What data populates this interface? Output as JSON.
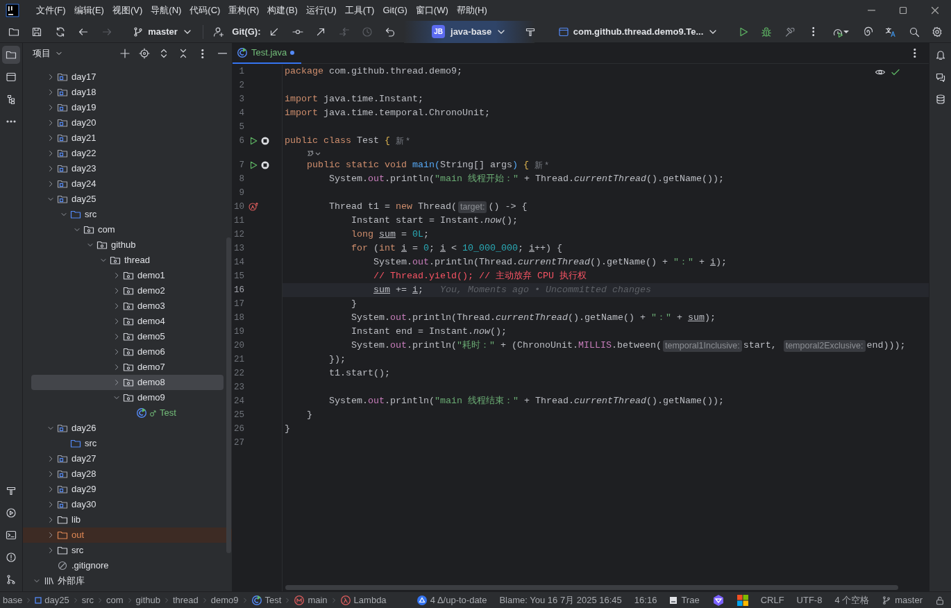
{
  "title_bar": {
    "menu": [
      "文件(F)",
      "编辑(E)",
      "视图(V)",
      "导航(N)",
      "代码(C)",
      "重构(R)",
      "构建(B)",
      "运行(U)",
      "工具(T)",
      "Git(G)",
      "窗口(W)",
      "帮助(H)"
    ]
  },
  "toolbar": {
    "nav": [
      {
        "kind": "folder",
        "disabled": false
      },
      {
        "kind": "save",
        "disabled": false
      },
      {
        "kind": "sync",
        "disabled": false
      },
      {
        "kind": "back",
        "disabled": false
      },
      {
        "kind": "forward",
        "disabled": true
      }
    ],
    "branch": "master",
    "git_label": "Git(G):",
    "git_actions": [
      {
        "kind": "update",
        "disabled": false
      },
      {
        "kind": "commit",
        "disabled": false
      },
      {
        "kind": "push",
        "disabled": false
      },
      {
        "kind": "merge",
        "disabled": true
      },
      {
        "kind": "history",
        "disabled": true
      },
      {
        "kind": "rollback",
        "disabled": false
      }
    ],
    "project": {
      "badge": "JB",
      "name": "java-base"
    },
    "run_config": "com.github.thread.demo9.Te..."
  },
  "left_strip": [
    {
      "kind": "folder",
      "selected": true
    },
    {
      "kind": "commit",
      "selected": false
    },
    {
      "kind": "structure",
      "selected": false
    },
    {
      "kind": "more",
      "selected": false
    }
  ],
  "left_strip_bottom": [
    {
      "kind": "build",
      "selected": false
    },
    {
      "kind": "run",
      "selected": false
    },
    {
      "kind": "terminal",
      "selected": false
    },
    {
      "kind": "problems",
      "selected": false
    },
    {
      "kind": "git",
      "selected": false
    }
  ],
  "project_panel": {
    "title": "项目",
    "tree": [
      {
        "label": "day17",
        "kind": "module",
        "expanded": false,
        "selected": false
      },
      {
        "label": "day18",
        "kind": "module",
        "expanded": false,
        "selected": false
      },
      {
        "label": "day19",
        "kind": "module",
        "expanded": false,
        "selected": false
      },
      {
        "label": "day20",
        "kind": "module",
        "expanded": false,
        "selected": false
      },
      {
        "label": "day21",
        "kind": "module",
        "expanded": false,
        "selected": false
      },
      {
        "label": "day22",
        "kind": "module",
        "expanded": false,
        "selected": false
      },
      {
        "label": "day23",
        "kind": "module",
        "expanded": false,
        "selected": false
      },
      {
        "label": "day24",
        "kind": "module",
        "expanded": false,
        "selected": false
      },
      {
        "label": "day25",
        "kind": "module",
        "expanded": true,
        "selected": false,
        "children": [
          {
            "label": "src",
            "kind": "source",
            "expanded": true,
            "selected": false,
            "children": [
              {
                "label": "com",
                "kind": "package",
                "expanded": true,
                "selected": false,
                "children": [
                  {
                    "label": "github",
                    "kind": "package",
                    "expanded": true,
                    "selected": false,
                    "children": [
                      {
                        "label": "thread",
                        "kind": "package",
                        "expanded": true,
                        "selected": false,
                        "children": [
                          {
                            "label": "demo1",
                            "kind": "package",
                            "expanded": false,
                            "selected": false
                          },
                          {
                            "label": "demo2",
                            "kind": "package",
                            "expanded": false,
                            "selected": false
                          },
                          {
                            "label": "demo3",
                            "kind": "package",
                            "expanded": false,
                            "selected": false
                          },
                          {
                            "label": "demo4",
                            "kind": "package",
                            "expanded": false,
                            "selected": false
                          },
                          {
                            "label": "demo5",
                            "kind": "package",
                            "expanded": false,
                            "selected": false
                          },
                          {
                            "label": "demo6",
                            "kind": "package",
                            "expanded": false,
                            "selected": false
                          },
                          {
                            "label": "demo7",
                            "kind": "package",
                            "expanded": false,
                            "selected": false
                          },
                          {
                            "label": "demo8",
                            "kind": "package",
                            "expanded": false,
                            "selected": true
                          },
                          {
                            "label": "demo9",
                            "kind": "package",
                            "expanded": true,
                            "selected": false,
                            "children": [
                              {
                                "label": "Test",
                                "kind": "class",
                                "added": true,
                                "selected": false
                              }
                            ]
                          }
                        ]
                      }
                    ]
                  }
                ]
              }
            ]
          }
        ]
      },
      {
        "label": "day26",
        "kind": "module",
        "expanded": true,
        "selected": false,
        "children": [
          {
            "label": "src",
            "kind": "source",
            "selected": false
          }
        ]
      },
      {
        "label": "day27",
        "kind": "module",
        "expanded": false,
        "selected": false
      },
      {
        "label": "day28",
        "kind": "module",
        "expanded": false,
        "selected": false
      },
      {
        "label": "day29",
        "kind": "module",
        "expanded": false,
        "selected": false
      },
      {
        "label": "day30",
        "kind": "module",
        "expanded": false,
        "selected": false
      },
      {
        "label": "lib",
        "kind": "folder",
        "expanded": false,
        "selected": false
      },
      {
        "label": "out",
        "kind": "excluded",
        "expanded": false,
        "selected": false
      },
      {
        "label": "src",
        "kind": "folder",
        "expanded": false,
        "selected": false
      },
      {
        "label": ".gitignore",
        "kind": "ignore",
        "selected": false
      }
    ]
  },
  "external_libraries": {
    "label": "外部库",
    "expanded": true
  },
  "editor": {
    "tabs": [
      {
        "label": "Test.java",
        "modified": true,
        "selected": true
      }
    ],
    "lines": [
      {
        "num": "1",
        "tokens": [
          {
            "kind": "kw",
            "t": "package"
          },
          {
            "kind": "p",
            "t": " com.github.thread.demo9;"
          }
        ]
      },
      {
        "num": "2"
      },
      {
        "num": "3",
        "tokens": [
          {
            "kind": "kw",
            "t": "import"
          },
          {
            "kind": "p",
            "t": " java.time.Instant;"
          }
        ]
      },
      {
        "num": "4",
        "tokens": [
          {
            "kind": "kw",
            "t": "import"
          },
          {
            "kind": "p",
            "t": " java.time.temporal.ChronoUnit;"
          }
        ]
      },
      {
        "num": "5"
      },
      {
        "num": "6",
        "gutter": [
          {
            "kind": "run"
          },
          {
            "kind": "stop"
          }
        ],
        "tokens": [
          {
            "kind": "kw",
            "t": "public class"
          },
          {
            "kind": "p",
            "t": " Test "
          },
          {
            "kind": "y",
            "t": "{"
          },
          {
            "kind": "g",
            "t": "新 *"
          }
        ]
      },
      {
        "num": "7",
        "vision": true,
        "gutter": [
          {
            "kind": "run"
          },
          {
            "kind": "stop"
          }
        ],
        "tokens": [
          {
            "kind": "kw",
            "t": "    public static void "
          },
          {
            "kind": "m",
            "t": "main"
          },
          {
            "kind": "b",
            "t": "("
          },
          {
            "kind": "p",
            "t": "String[] args"
          },
          {
            "kind": "b",
            "t": ") "
          },
          {
            "kind": "y",
            "t": "{"
          },
          {
            "kind": "g",
            "t": "新 *"
          }
        ]
      },
      {
        "num": "8",
        "tokens": [
          {
            "kind": "p",
            "t": "        System."
          },
          {
            "kind": "f",
            "t": "out"
          },
          {
            "kind": "p",
            "t": ".println("
          },
          {
            "kind": "s",
            "t": "\"main 线程开始：\""
          },
          {
            "kind": "p",
            "t": " + Thread."
          },
          {
            "kind": "i",
            "t": "currentThread"
          },
          {
            "kind": "p",
            "t": "().getName());"
          }
        ]
      },
      {
        "num": "9"
      },
      {
        "num": "10",
        "gutter": [
          {
            "kind": "lambda"
          }
        ],
        "tokens": [
          {
            "kind": "p",
            "t": "        Thread t1 = "
          },
          {
            "kind": "kw",
            "t": "new"
          },
          {
            "kind": "p",
            "t": " Thread("
          },
          {
            "kind": "h",
            "t": "target:"
          },
          {
            "kind": "p",
            "t": "() -> {"
          }
        ]
      },
      {
        "num": "11",
        "tokens": [
          {
            "kind": "p",
            "t": "            Instant start = Instant."
          },
          {
            "kind": "i",
            "t": "now"
          },
          {
            "kind": "p",
            "t": "();"
          }
        ]
      },
      {
        "num": "12",
        "tokens": [
          {
            "kind": "kw",
            "t": "            long "
          },
          {
            "kind": "u",
            "t": "sum"
          },
          {
            "kind": "p",
            "t": " = "
          },
          {
            "kind": "n",
            "t": "0L"
          },
          {
            "kind": "p",
            "t": ";"
          }
        ]
      },
      {
        "num": "13",
        "tokens": [
          {
            "kind": "kw",
            "t": "            for"
          },
          {
            "kind": "p",
            "t": " ("
          },
          {
            "kind": "kw",
            "t": "int "
          },
          {
            "kind": "u",
            "t": "i"
          },
          {
            "kind": "p",
            "t": " = "
          },
          {
            "kind": "n",
            "t": "0"
          },
          {
            "kind": "p",
            "t": "; "
          },
          {
            "kind": "u",
            "t": "i"
          },
          {
            "kind": "p",
            "t": " < "
          },
          {
            "kind": "n",
            "t": "10_000_000"
          },
          {
            "kind": "p",
            "t": "; "
          },
          {
            "kind": "u",
            "t": "i"
          },
          {
            "kind": "p",
            "t": "++) {"
          }
        ]
      },
      {
        "num": "14",
        "tokens": [
          {
            "kind": "p",
            "t": "                System."
          },
          {
            "kind": "f",
            "t": "out"
          },
          {
            "kind": "p",
            "t": ".println(Thread."
          },
          {
            "kind": "i",
            "t": "currentThread"
          },
          {
            "kind": "p",
            "t": "().getName() + "
          },
          {
            "kind": "s",
            "t": "\"：\""
          },
          {
            "kind": "p",
            "t": " + "
          },
          {
            "kind": "u",
            "t": "i"
          },
          {
            "kind": "p",
            "t": ");"
          }
        ]
      },
      {
        "num": "15",
        "tokens": [
          {
            "kind": "c",
            "t": "                // Thread.yield(); // 主动放弃 CPU 执行权"
          }
        ]
      },
      {
        "num": "16",
        "current": true,
        "tokens": [
          {
            "kind": "u",
            "t": "                sum"
          },
          {
            "kind": "p",
            "t": " += "
          },
          {
            "kind": "u",
            "t": "i"
          },
          {
            "kind": "p",
            "t": ";"
          },
          {
            "kind": "a",
            "t": "You, Moments ago • Uncommitted changes"
          }
        ]
      },
      {
        "num": "17",
        "tokens": [
          {
            "kind": "p",
            "t": "            }"
          }
        ]
      },
      {
        "num": "18",
        "tokens": [
          {
            "kind": "p",
            "t": "            System."
          },
          {
            "kind": "f",
            "t": "out"
          },
          {
            "kind": "p",
            "t": ".println(Thread."
          },
          {
            "kind": "i",
            "t": "currentThread"
          },
          {
            "kind": "p",
            "t": "().getName() + "
          },
          {
            "kind": "s",
            "t": "\"：\""
          },
          {
            "kind": "p",
            "t": " + "
          },
          {
            "kind": "u",
            "t": "sum"
          },
          {
            "kind": "p",
            "t": ");"
          }
        ]
      },
      {
        "num": "19",
        "tokens": [
          {
            "kind": "p",
            "t": "            Instant end = Instant."
          },
          {
            "kind": "i",
            "t": "now"
          },
          {
            "kind": "p",
            "t": "();"
          }
        ]
      },
      {
        "num": "20",
        "tokens": [
          {
            "kind": "p",
            "t": "            System."
          },
          {
            "kind": "f",
            "t": "out"
          },
          {
            "kind": "p",
            "t": ".println("
          },
          {
            "kind": "s",
            "t": "\"耗时：\""
          },
          {
            "kind": "p",
            "t": " + (ChronoUnit."
          },
          {
            "kind": "f",
            "t": "MILLIS"
          },
          {
            "kind": "p",
            "t": ".between("
          },
          {
            "kind": "h",
            "t": "temporal1Inclusive:"
          },
          {
            "kind": "p",
            "t": "start, "
          },
          {
            "kind": "h",
            "t": "temporal2Exclusive:"
          },
          {
            "kind": "p",
            "t": "end)));"
          }
        ]
      },
      {
        "num": "21",
        "tokens": [
          {
            "kind": "p",
            "t": "        });"
          }
        ]
      },
      {
        "num": "22",
        "tokens": [
          {
            "kind": "p",
            "t": "        t1.start();"
          }
        ]
      },
      {
        "num": "23"
      },
      {
        "num": "24",
        "tokens": [
          {
            "kind": "p",
            "t": "        System."
          },
          {
            "kind": "f",
            "t": "out"
          },
          {
            "kind": "p",
            "t": ".println("
          },
          {
            "kind": "s",
            "t": "\"main 线程结束：\""
          },
          {
            "kind": "p",
            "t": " + Thread."
          },
          {
            "kind": "i",
            "t": "currentThread"
          },
          {
            "kind": "p",
            "t": "().getName());"
          }
        ]
      },
      {
        "num": "25",
        "tokens": [
          {
            "kind": "p",
            "t": "    }"
          }
        ]
      },
      {
        "num": "26",
        "tokens": [
          {
            "kind": "p",
            "t": "}"
          }
        ]
      },
      {
        "num": "27"
      }
    ]
  },
  "status_bar": {
    "breadcrumbs": [
      {
        "label": "base",
        "kind": "none"
      },
      {
        "label": "day25",
        "kind": "module"
      },
      {
        "label": "src",
        "kind": "none"
      },
      {
        "label": "com",
        "kind": "none"
      },
      {
        "label": "github",
        "kind": "none"
      },
      {
        "label": "thread",
        "kind": "none"
      },
      {
        "label": "demo9",
        "kind": "none"
      },
      {
        "label": "Test",
        "kind": "class"
      },
      {
        "label": "main",
        "kind": "method"
      },
      {
        "label": "Lambda",
        "kind": "lambda"
      }
    ],
    "items": [
      {
        "label": "4 Δ/up-to-date",
        "kind": "vcs"
      },
      {
        "label": "Blame: You 16 7月 2025 16:45",
        "kind": "text"
      },
      {
        "label": "16:16",
        "kind": "text"
      },
      {
        "label": "Trae",
        "kind": "trae"
      },
      {
        "kind": "plugin"
      },
      {
        "kind": "windows"
      },
      {
        "label": "CRLF",
        "kind": "text"
      },
      {
        "label": "UTF-8",
        "kind": "text"
      },
      {
        "label": "4 个空格",
        "kind": "text"
      },
      {
        "label": "master",
        "kind": "branch"
      },
      {
        "kind": "lock"
      }
    ]
  }
}
